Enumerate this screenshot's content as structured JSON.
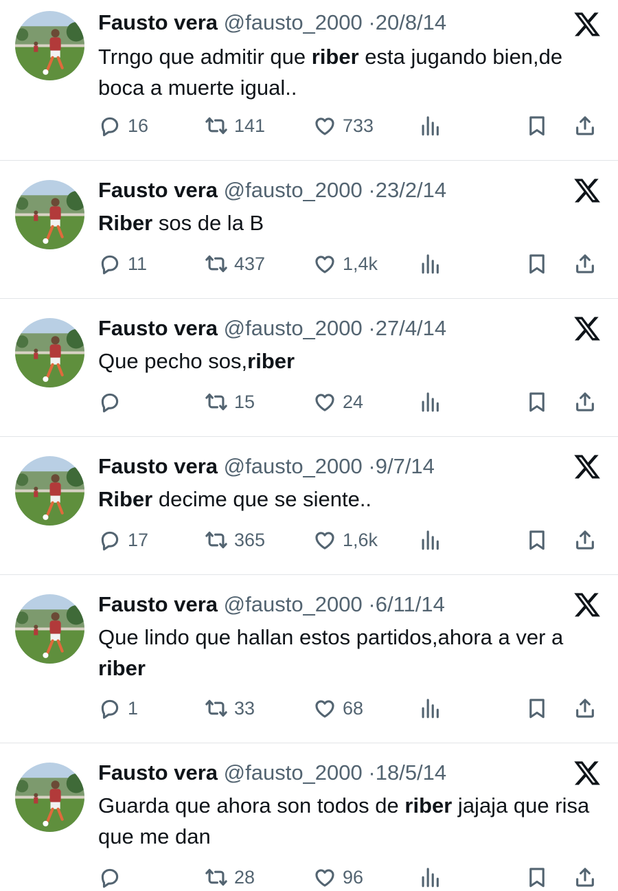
{
  "tweets": [
    {
      "name": "Fausto vera",
      "handle": "@fausto_2000",
      "separator": "·",
      "date": "20/8/14",
      "text": [
        {
          "t": "Trngo que admitir que ",
          "b": false
        },
        {
          "t": "riber",
          "b": true
        },
        {
          "t": " esta jugando bien,de boca a muerte igual..",
          "b": false
        }
      ],
      "replies": "16",
      "retweets": "141",
      "likes": "733"
    },
    {
      "name": "Fausto vera",
      "handle": "@fausto_2000",
      "separator": "·",
      "date": "23/2/14",
      "text": [
        {
          "t": "Riber",
          "b": true
        },
        {
          "t": " sos de la B",
          "b": false
        }
      ],
      "replies": "11",
      "retweets": "437",
      "likes": "1,4k"
    },
    {
      "name": "Fausto vera",
      "handle": "@fausto_2000",
      "separator": "·",
      "date": "27/4/14",
      "text": [
        {
          "t": "Que pecho sos,",
          "b": false
        },
        {
          "t": "riber",
          "b": true
        }
      ],
      "replies": "",
      "retweets": "15",
      "likes": "24"
    },
    {
      "name": "Fausto vera",
      "handle": "@fausto_2000",
      "separator": "·",
      "date": "9/7/14",
      "text": [
        {
          "t": "Riber",
          "b": true
        },
        {
          "t": " decime que se siente..",
          "b": false
        }
      ],
      "replies": "17",
      "retweets": "365",
      "likes": "1,6k"
    },
    {
      "name": "Fausto vera",
      "handle": "@fausto_2000",
      "separator": "·",
      "date": "6/11/14",
      "text": [
        {
          "t": "Que lindo que hallan estos partidos,ahora a ver a ",
          "b": false
        },
        {
          "t": "riber",
          "b": true
        }
      ],
      "replies": "1",
      "retweets": "33",
      "likes": "68"
    },
    {
      "name": "Fausto vera",
      "handle": "@fausto_2000",
      "separator": "·",
      "date": "18/5/14",
      "text": [
        {
          "t": "Guarda que ahora son todos de ",
          "b": false
        },
        {
          "t": "riber",
          "b": true
        },
        {
          "t": " jajaja que risa que me dan",
          "b": false
        }
      ],
      "replies": "",
      "retweets": "28",
      "likes": "96"
    }
  ],
  "icons": {
    "reply": "reply-icon",
    "retweet": "retweet-icon",
    "like": "like-icon",
    "views": "views-icon",
    "bookmark": "bookmark-icon",
    "share": "share-icon",
    "logo": "x-logo-icon"
  },
  "colors": {
    "text": "#0f1419",
    "muted": "#536471",
    "divider": "#e2e5e8"
  }
}
